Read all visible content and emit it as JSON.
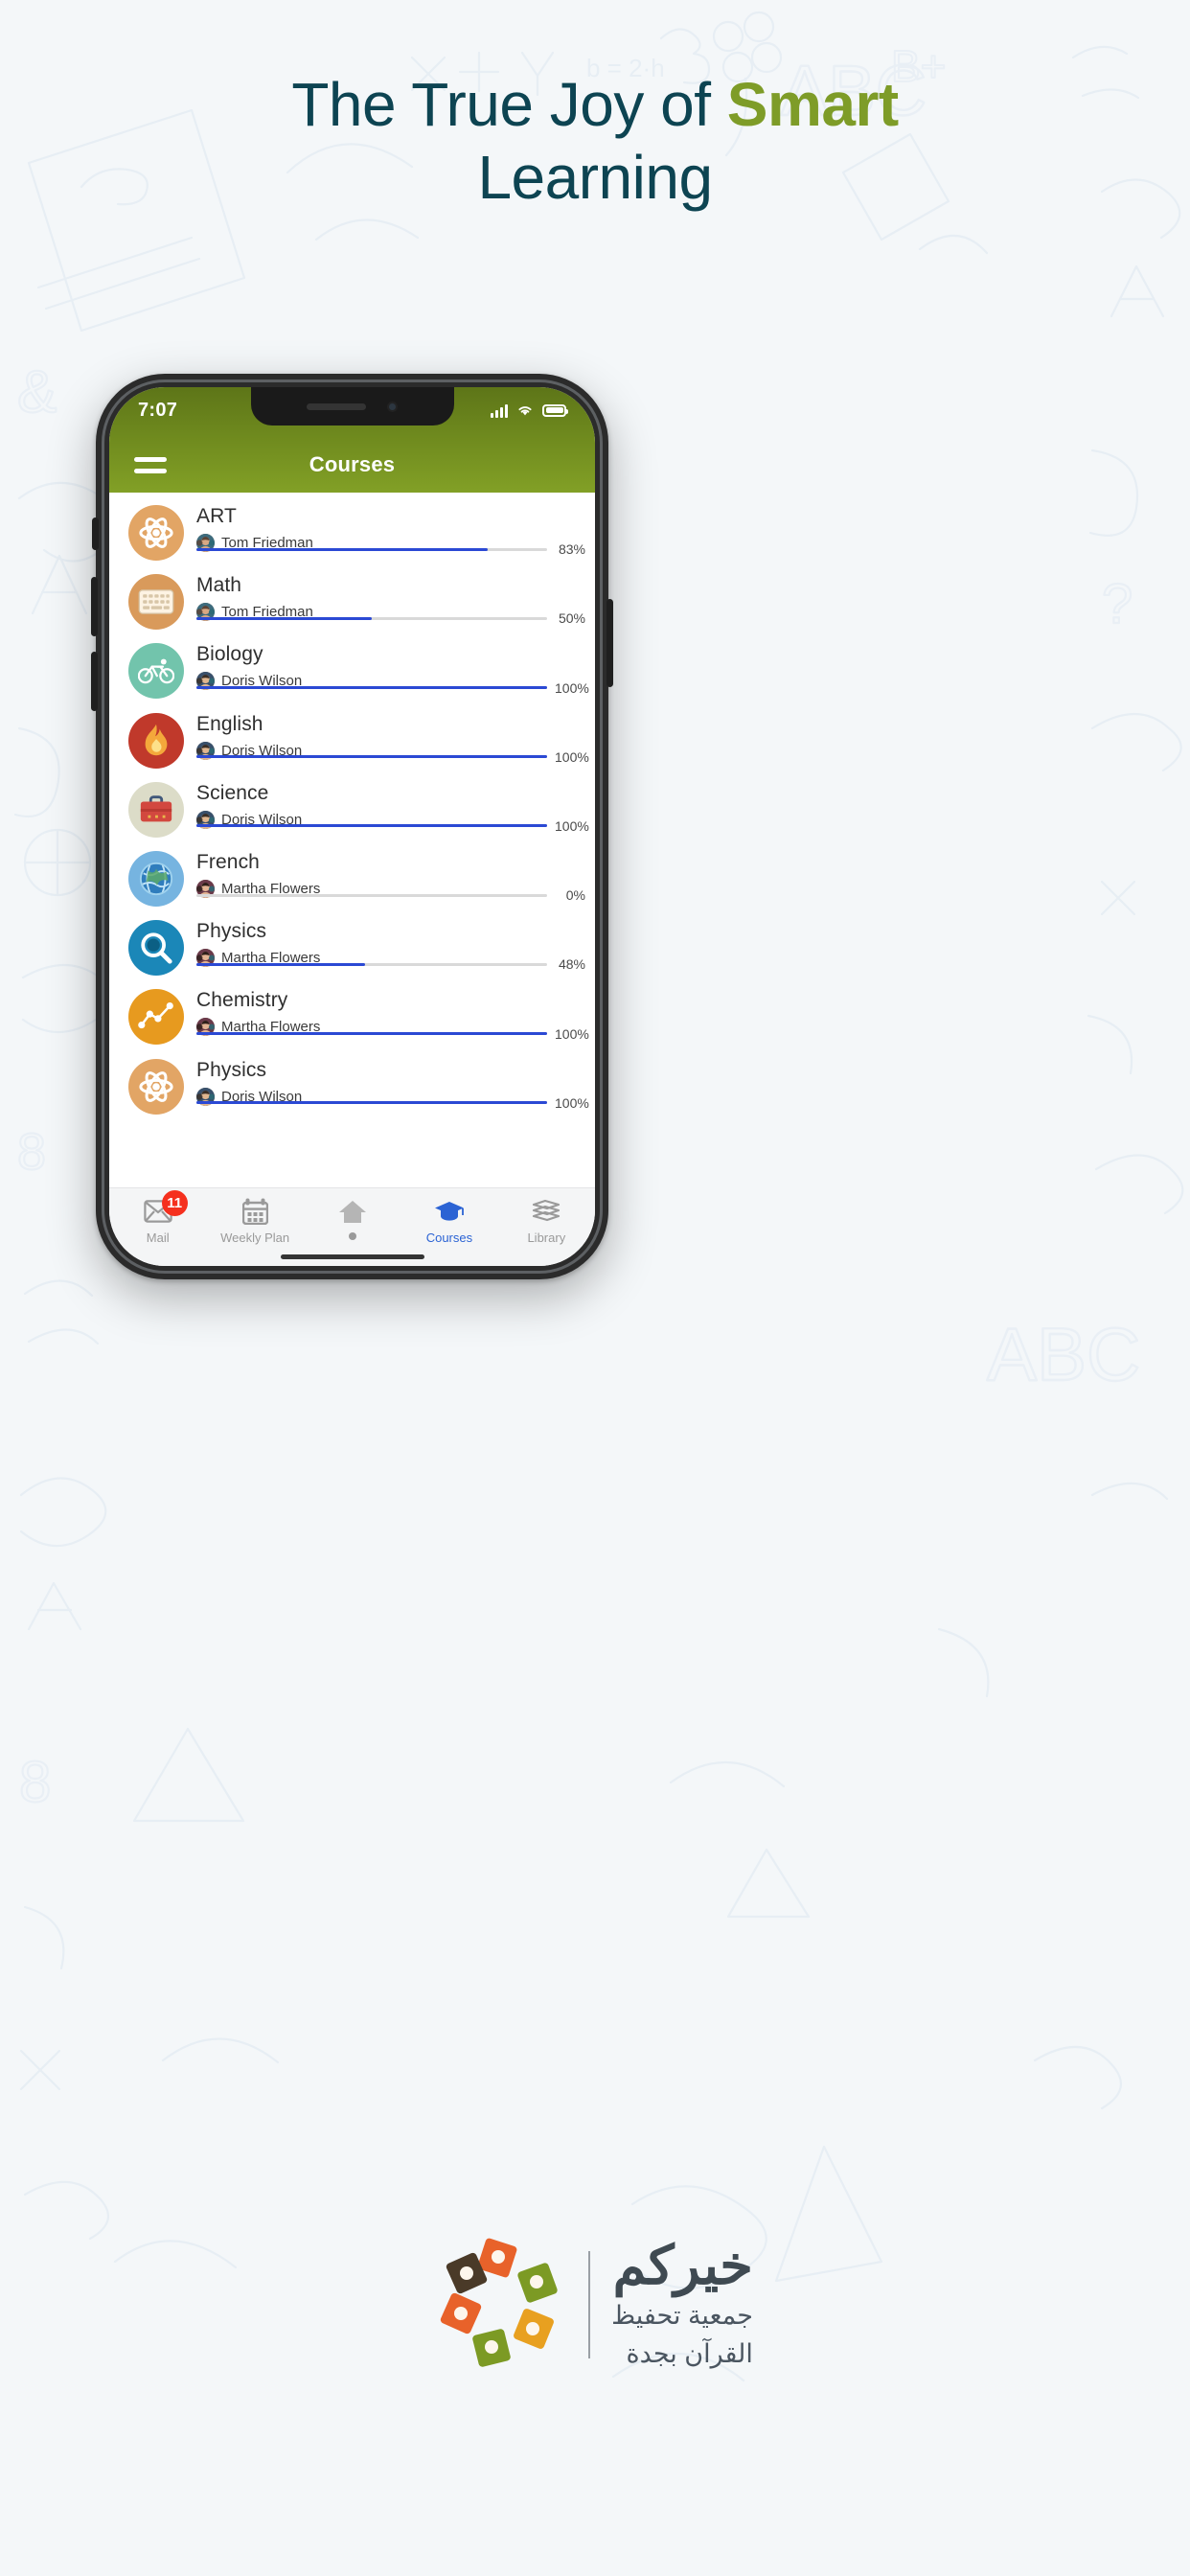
{
  "hero": {
    "line1_plain": "The True Joy of ",
    "line1_accent": "Smart",
    "line2": "Learning",
    "accent_color": "#7e9c28",
    "text_color": "#0d4452"
  },
  "phone": {
    "status_bar": {
      "time": "7:07",
      "signal_icon": "cellular-signal-icon",
      "wifi_icon": "wifi-icon",
      "battery_icon": "battery-full-icon"
    },
    "app_bar": {
      "menu_icon": "hamburger-menu-icon",
      "title": "Courses",
      "background_color": "#7a9522"
    },
    "courses": [
      {
        "title": "ART",
        "teacher": "Tom Friedman",
        "progress": 83,
        "percent_label": "83%",
        "icon": "atom-icon",
        "icon_bg": "#e2a565",
        "icon_color": "#ffffff"
      },
      {
        "title": "Math",
        "teacher": "Tom Friedman",
        "progress": 50,
        "percent_label": "50%",
        "icon": "keyboard-icon",
        "icon_bg": "#d99a5b",
        "icon_color": "#ffffff"
      },
      {
        "title": "Biology",
        "teacher": "Doris Wilson",
        "progress": 100,
        "percent_label": "100%",
        "icon": "bicycle-icon",
        "icon_bg": "#72c4ac",
        "icon_color": "#ffffff"
      },
      {
        "title": "English",
        "teacher": "Doris Wilson",
        "progress": 100,
        "percent_label": "100%",
        "icon": "flame-icon",
        "icon_bg": "#c0392b",
        "icon_color": "#f4a83b"
      },
      {
        "title": "Science",
        "teacher": "Doris Wilson",
        "progress": 100,
        "percent_label": "100%",
        "icon": "briefcase-icon",
        "icon_bg": "#dcdcc8",
        "icon_color": "#d2483f"
      },
      {
        "title": "French",
        "teacher": "Martha Flowers",
        "progress": 0,
        "percent_label": "0%",
        "icon": "globe-icon",
        "icon_bg": "#76b4e0",
        "icon_color": "#ffffff"
      },
      {
        "title": "Physics",
        "teacher": "Martha Flowers",
        "progress": 48,
        "percent_label": "48%",
        "icon": "magnifier-icon",
        "icon_bg": "#1b87b8",
        "icon_color": "#ffffff"
      },
      {
        "title": "Chemistry",
        "teacher": "Martha Flowers",
        "progress": 100,
        "percent_label": "100%",
        "icon": "line-chart-icon",
        "icon_bg": "#e79a1f",
        "icon_color": "#ffffff"
      },
      {
        "title": "Physics",
        "teacher": "Doris Wilson",
        "progress": 100,
        "percent_label": "100%",
        "icon": "atom-icon",
        "icon_bg": "#e2a565",
        "icon_color": "#ffffff"
      }
    ],
    "progress_bar_color": "#2b49d4",
    "tabs": [
      {
        "label": "Mail",
        "icon": "mail-icon",
        "badge": "11",
        "active": false
      },
      {
        "label": "Weekly Plan",
        "icon": "calendar-icon",
        "badge": "",
        "active": false
      },
      {
        "label": "",
        "icon": "home-icon",
        "badge": "",
        "active": false
      },
      {
        "label": "Courses",
        "icon": "graduation-cap-icon",
        "badge": "",
        "active": true
      },
      {
        "label": "Library",
        "icon": "books-icon",
        "badge": "",
        "active": false
      }
    ],
    "active_tab_color": "#2b63d4",
    "badge_color": "#f5301e"
  },
  "footer": {
    "logo_icon": "pinwheel-logo-icon",
    "arabic_main": "خيركم",
    "arabic_sub_line1": "جمعية تحفيظ",
    "arabic_sub_line2": "القرآن بجدة"
  }
}
